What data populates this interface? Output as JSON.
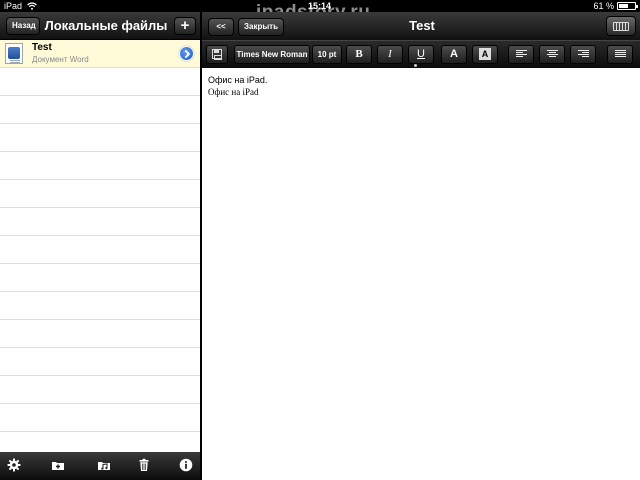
{
  "status": {
    "device": "iPad",
    "time": "15:14",
    "battery": "61 %",
    "battery_level": 0.61
  },
  "watermark": "ipadstory.ru",
  "left_panel": {
    "back_label": "Назад",
    "title": "Локальные файлы",
    "add_label": "+",
    "files": [
      {
        "name": "Test",
        "type": "Документ Word"
      }
    ],
    "toolbar_icons": [
      "gear-icon",
      "new-folder-icon",
      "folder-music-icon",
      "trash-icon",
      "info-icon"
    ]
  },
  "right_panel": {
    "collapse_label": "<<",
    "close_label": "Закрыть",
    "title": "Test",
    "format_bar": {
      "font": "Times New Roman",
      "size": "10 pt",
      "bold": "B",
      "italic": "I",
      "underline": "U",
      "font_color": "A",
      "highlight": "A"
    },
    "document_lines": [
      "Офис на iPad.",
      "Офис на iPad"
    ]
  },
  "colors": {
    "selected_row": "#fffbd8",
    "disclosure": "#1b59c6",
    "bar_dark": "#111111"
  }
}
